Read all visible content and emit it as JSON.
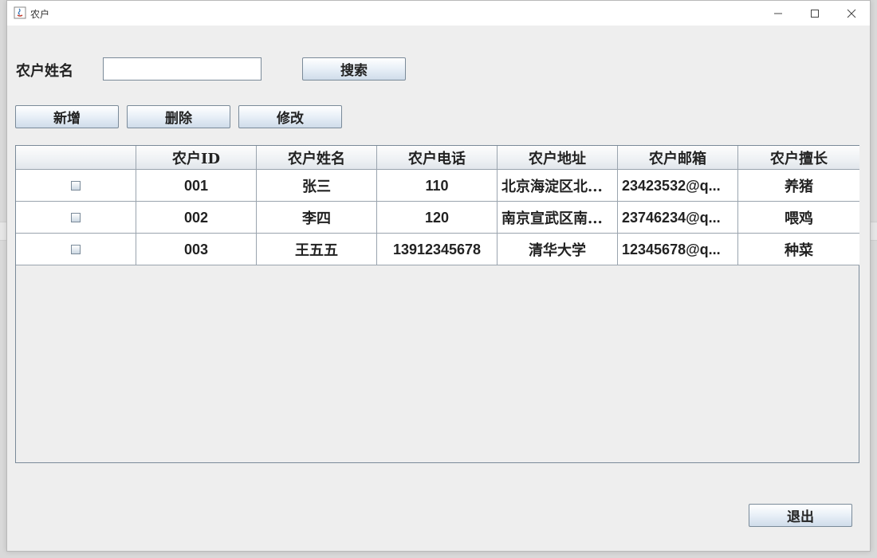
{
  "window": {
    "title": "农户"
  },
  "search": {
    "label": "农户姓名",
    "value": "",
    "button": "搜索"
  },
  "toolbar": {
    "add": "新增",
    "delete": "删除",
    "edit": "修改"
  },
  "table": {
    "columns": [
      "",
      "农户ID",
      "农户姓名",
      "农户电话",
      "农户地址",
      "农户邮箱",
      "农户擅长"
    ],
    "rows": [
      {
        "checked": false,
        "id": "001",
        "name": "张三",
        "phone": "110",
        "address": "北京海淀区北...",
        "email": "23423532@q...",
        "skill": "养猪"
      },
      {
        "checked": false,
        "id": "002",
        "name": "李四",
        "phone": "120",
        "address": "南京宣武区南...",
        "email": "23746234@q...",
        "skill": "喂鸡"
      },
      {
        "checked": false,
        "id": "003",
        "name": "王五五",
        "phone": "13912345678",
        "address": "清华大学",
        "email": "12345678@q...",
        "skill": "种菜"
      }
    ]
  },
  "footer": {
    "exit": "退出"
  }
}
